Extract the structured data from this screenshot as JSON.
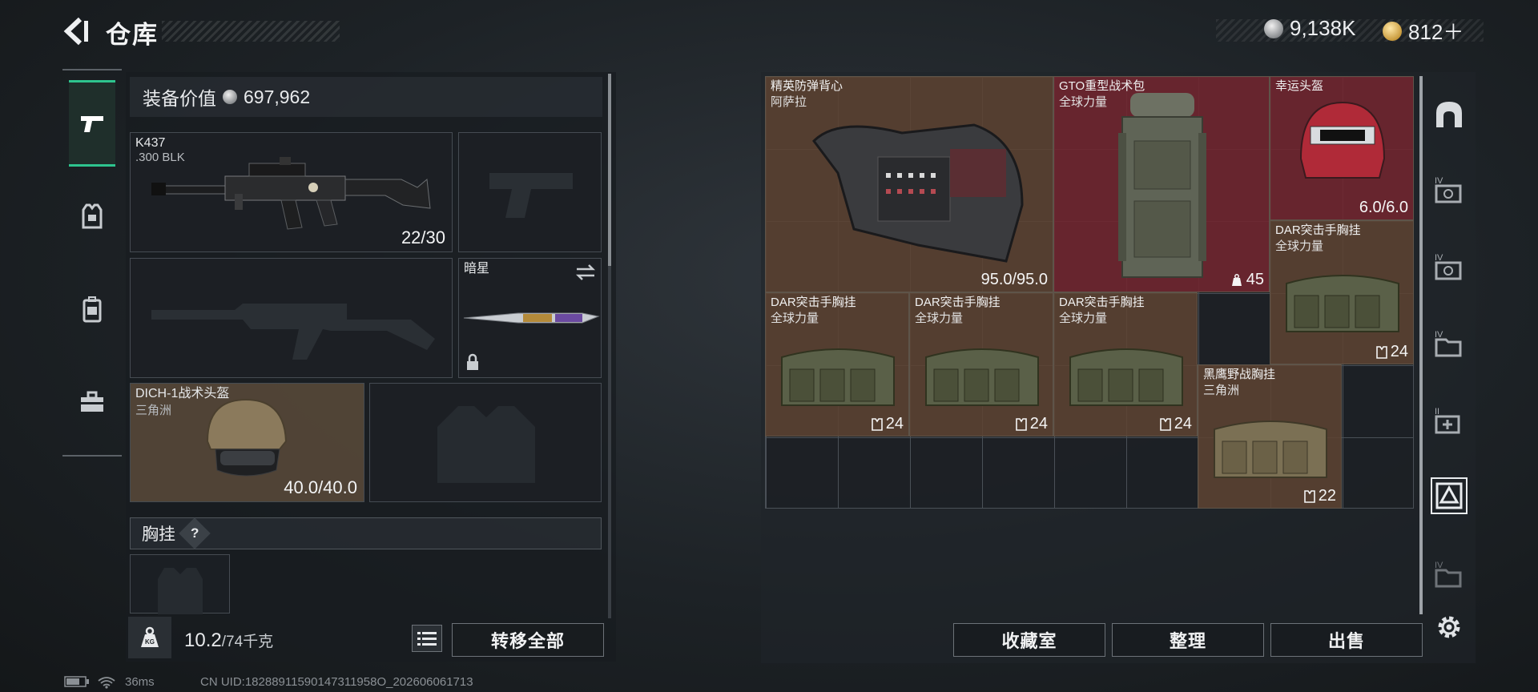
{
  "header": {
    "title": "仓库",
    "currency_silver": "9,138K",
    "currency_gold": "812＋"
  },
  "loadout": {
    "value_label": "装备价值",
    "value": "697,962",
    "primary_weapon": {
      "name": "K437",
      "ammo_type": ".300 BLK",
      "ammo": "22/30"
    },
    "melee": {
      "name": "暗星"
    },
    "helmet": {
      "name": "DICH-1战术头盔",
      "map": "三角洲",
      "durability": "40.0/40.0"
    },
    "rig_section_label": "胸挂",
    "rig_help": "?"
  },
  "footer_left": {
    "weight": "10.2",
    "weight_max": "/74千克",
    "transfer_all": "转移全部"
  },
  "storage": {
    "items": [
      {
        "name": "精英防弹背心",
        "sub": "阿萨拉",
        "stat": "95.0/95.0"
      },
      {
        "name": "GTO重型战术包",
        "sub": "全球力量",
        "stat": "45"
      },
      {
        "name": "幸运头盔",
        "sub": "",
        "stat": "6.0/6.0"
      },
      {
        "name": "DAR突击手胸挂",
        "sub": "全球力量",
        "stat": "24"
      },
      {
        "name": "DAR突击手胸挂",
        "sub": "全球力量",
        "stat": "24"
      },
      {
        "name": "DAR突击手胸挂",
        "sub": "全球力量",
        "stat": "24"
      },
      {
        "name": "DAR突击手胸挂",
        "sub": "全球力量",
        "stat": "24"
      },
      {
        "name": "黑鹰野战胸挂",
        "sub": "三角洲",
        "stat": "22"
      }
    ]
  },
  "footer_right": {
    "collection": "收藏室",
    "organize": "整理",
    "sell": "出售"
  },
  "status_bar": {
    "ping": "36ms",
    "uid": "CN UID:18288911590147311958O_202606061713"
  },
  "colors": {
    "accent_green": "#2ec48e",
    "item_brown": "#5c4232",
    "item_red": "#702630"
  },
  "icons": {
    "back": "chevron-left-icon",
    "weapon_tab": "pistol-icon",
    "armor_tab": "vest-icon",
    "bag_tab": "backpack-icon",
    "case_tab": "toolbox-icon",
    "settings": "gear-icon"
  }
}
